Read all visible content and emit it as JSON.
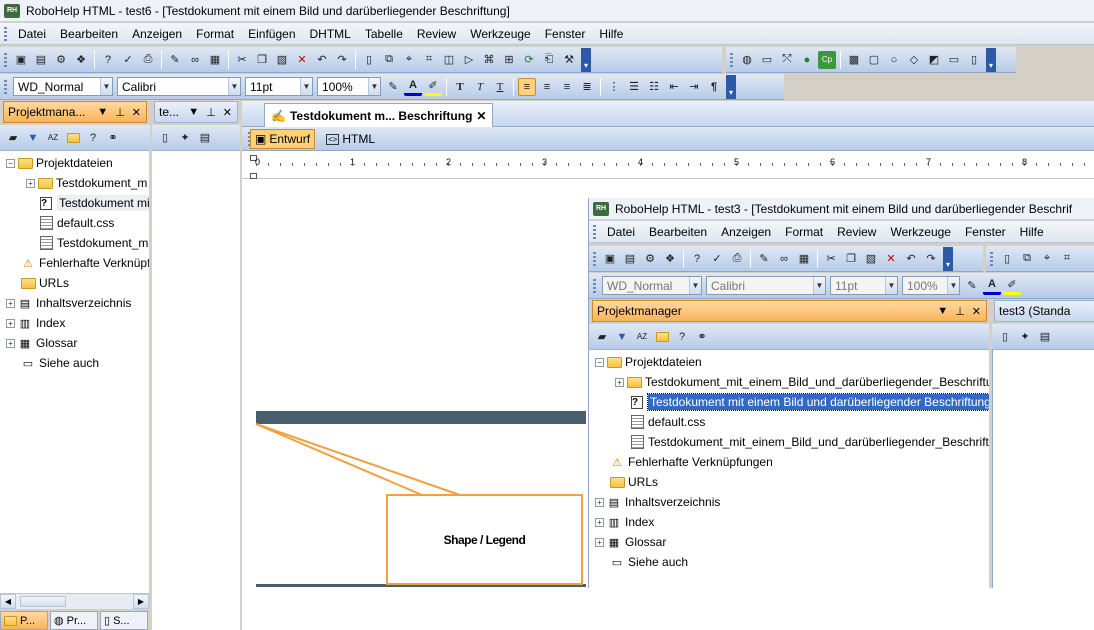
{
  "main": {
    "title": "RoboHelp HTML - test6 - [Testdokument mit einem Bild und darüberliegender Beschriftung]",
    "app_icon": "RH",
    "menu": [
      "Datei",
      "Bearbeiten",
      "Anzeigen",
      "Format",
      "Einfügen",
      "DHTML",
      "Tabelle",
      "Review",
      "Werkzeuge",
      "Fenster",
      "Hilfe"
    ],
    "format_bar": {
      "style": "WD_Normal",
      "font": "Calibri",
      "size": "11pt",
      "zoom": "100%"
    },
    "project_pane": {
      "title": "Projektmana...",
      "controls": [
        "▼",
        "⊥",
        "✕"
      ],
      "tree": [
        {
          "label": "Projektdateien",
          "icon": "folder-open"
        },
        {
          "label": "Testdokument_m",
          "icon": "folder"
        },
        {
          "label": "Testdokument mit",
          "icon": "help"
        },
        {
          "label": "default.css",
          "icon": "css"
        },
        {
          "label": "Testdokument_m",
          "icon": "css"
        },
        {
          "label": "Fehlerhafte Verknüpfu",
          "icon": "broken-link"
        },
        {
          "label": "URLs",
          "icon": "url"
        },
        {
          "label": "Inhaltsverzeichnis",
          "icon": "toc"
        },
        {
          "label": "Index",
          "icon": "index"
        },
        {
          "label": "Glossar",
          "icon": "glossary"
        },
        {
          "label": "Siehe auch",
          "icon": "see-also"
        }
      ],
      "bottom_tabs": [
        "P...",
        "Pr...",
        "S..."
      ]
    },
    "topic_pane": {
      "title": "te...",
      "controls": [
        "▼",
        "⊥",
        "✕"
      ]
    },
    "doc_tab": "Testdokument m... Beschriftung",
    "view_tabs": {
      "design": "Entwurf",
      "html": "HTML"
    },
    "ruler_numbers": [
      "1",
      "2",
      "3",
      "4",
      "5",
      "6",
      "7",
      "8"
    ],
    "shape_legend": "Shape / Legend"
  },
  "inner": {
    "title": "RoboHelp HTML - test3 - [Testdokument mit einem Bild und darüberliegender Beschrif",
    "menu": [
      "Datei",
      "Bearbeiten",
      "Anzeigen",
      "Format",
      "Review",
      "Werkzeuge",
      "Fenster",
      "Hilfe"
    ],
    "format_bar": {
      "style": "WD_Normal",
      "font": "Calibri",
      "size": "11pt",
      "zoom": "100%"
    },
    "project_pane": {
      "title": "Projektmanager",
      "tree": [
        {
          "label": "Projektdateien"
        },
        {
          "label": "Testdokument_mit_einem_Bild_und_darüberliegender_Beschriftung-Da"
        },
        {
          "label": "Testdokument mit einem Bild und darüberliegender Beschriftung"
        },
        {
          "label": "default.css"
        },
        {
          "label": "Testdokument_mit_einem_Bild_und_darüberliegender_Beschriftung.css"
        },
        {
          "label": "Fehlerhafte Verknüpfungen"
        },
        {
          "label": "URLs"
        },
        {
          "label": "Inhaltsverzeichnis"
        },
        {
          "label": "Index"
        },
        {
          "label": "Glossar"
        },
        {
          "label": "Siehe auch"
        }
      ]
    },
    "topic_pane_title": "test3 (Standa"
  },
  "colors": {
    "accent": "#f9b45a",
    "selection": "#316ac5",
    "callout": "#f0a040",
    "bar": "#4a5f6e"
  }
}
